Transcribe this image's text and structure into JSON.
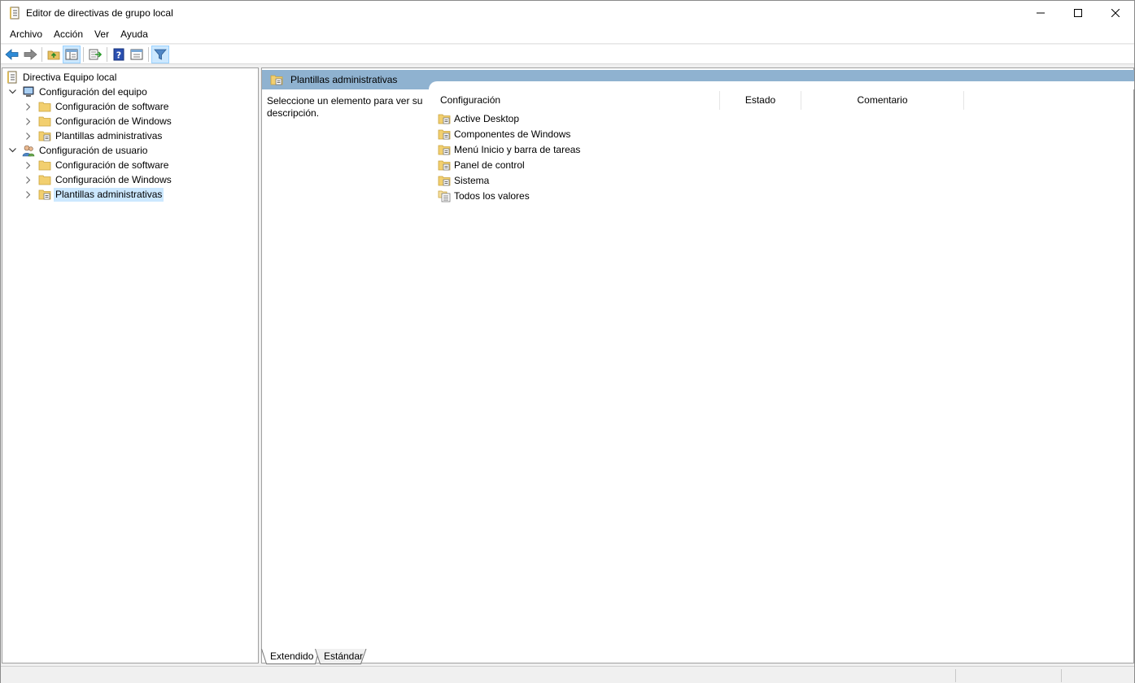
{
  "window": {
    "title": "Editor de directivas de grupo local",
    "icon": "policy-editor-icon"
  },
  "menu": {
    "items": [
      "Archivo",
      "Acción",
      "Ver",
      "Ayuda"
    ]
  },
  "toolbar": {
    "buttons": [
      "back-arrow-icon",
      "forward-arrow-icon",
      "up-folder-icon",
      "show-hide-tree-icon",
      "export-list-icon",
      "help-icon",
      "properties-icon",
      "filter-icon"
    ]
  },
  "tree": {
    "root": "Directiva Equipo local",
    "computer": {
      "label": "Configuración del equipo",
      "children": [
        "Configuración de software",
        "Configuración de Windows",
        "Plantillas administrativas"
      ]
    },
    "user": {
      "label": "Configuración de usuario",
      "children": [
        "Configuración de software",
        "Configuración de Windows",
        "Plantillas administrativas"
      ]
    }
  },
  "content": {
    "header": "Plantillas administrativas",
    "description": "Seleccione un elemento para ver su descripción.",
    "columns": [
      "Configuración",
      "Estado",
      "Comentario"
    ],
    "items": [
      "Active Desktop",
      "Componentes de Windows",
      "Menú Inicio y barra de tareas",
      "Panel de control",
      "Sistema",
      "Todos los valores"
    ]
  },
  "tabs": [
    "Extendido",
    "Estándar"
  ],
  "colors": {
    "header_band": "#8fb2d0",
    "selection": "#cce8ff",
    "folder": "#e8c060"
  }
}
